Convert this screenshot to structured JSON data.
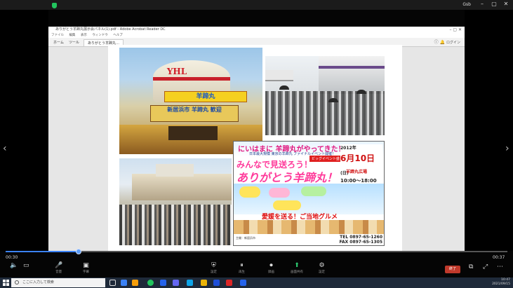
{
  "player": {
    "top_right_label": "Gsb",
    "time_current": "00:30",
    "time_total": "00:37",
    "progress_fraction": 0.145
  },
  "app": {
    "title": "ありがとう羊蹄丸展示会パネル(1).pdf - Adobe Acrobat Reader DC",
    "menu": [
      "ファイル",
      "編集",
      "表示",
      "ウィンドウ",
      "ヘルプ"
    ],
    "tabs": [
      "ホーム",
      "ツール",
      "ありがとう羊蹄丸…"
    ],
    "sign_in": "ログイン"
  },
  "poster": {
    "title_line1": "にいはまに 羊蹄丸がやってきた！",
    "subtitle": "日本最大規模 東京の羊蹄丸 ファイナルイベント開催！",
    "badge": "ビッグイベント盛り沢山！",
    "year": "2012年",
    "day": "6月10日",
    "weekday": "(日)",
    "time": "10:00〜18:00",
    "main_line1": "みんなで見送ろう！",
    "main_line2": "ありがとう羊蹄丸！",
    "venue": "羊蹄丸広場",
    "gourmet": "愛媛を送る！ご当地グルメ",
    "tel": "TEL 0897-65-1260",
    "fax": "FAX 0897-65-1305",
    "org": "主催：新居浜市"
  },
  "funnel_logo": "YHL",
  "ship_banner": "羊蹄丸",
  "ship_banner2": "新居浜市 羊蹄丸 歓迎",
  "controls": {
    "volume": "音量",
    "subtitles": "字幕",
    "play_pause": "再生",
    "record": "録画",
    "green_btn": "画面共有",
    "settings": "設定",
    "red_btn": "終了"
  },
  "taskbar": {
    "search_placeholder": "ここに入力して検索",
    "time": "10:47",
    "date": "2021/09/15"
  }
}
